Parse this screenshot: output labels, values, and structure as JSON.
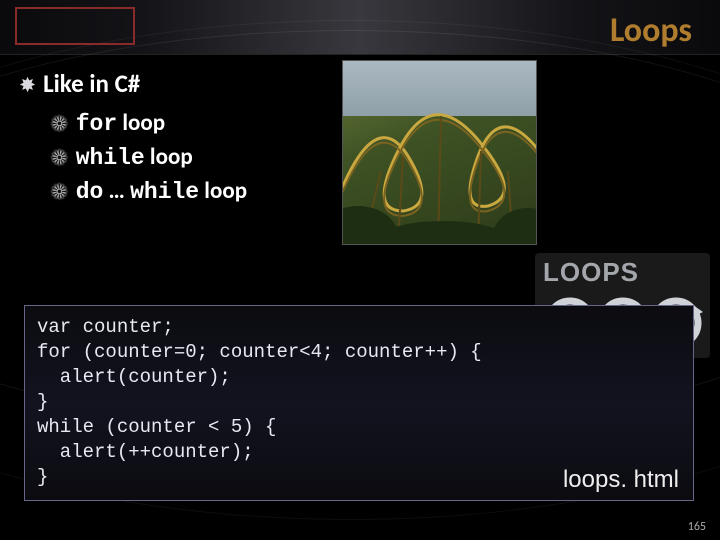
{
  "title": "Loops",
  "heading": {
    "text": "Like in C#"
  },
  "bullets": [
    {
      "code": "for",
      "rest": " loop"
    },
    {
      "code": "while",
      "rest": " loop"
    },
    {
      "code": "do",
      "mid": " … ",
      "code2": "while",
      "rest": " loop"
    }
  ],
  "code": "var counter;\nfor (counter=0; counter<4; counter++) {\n  alert(counter);\n}\nwhile (counter < 5) {\n  alert(++counter);\n}",
  "file_label": "loops. html",
  "loops_badge_text": "LOOPS",
  "page_number": "165"
}
